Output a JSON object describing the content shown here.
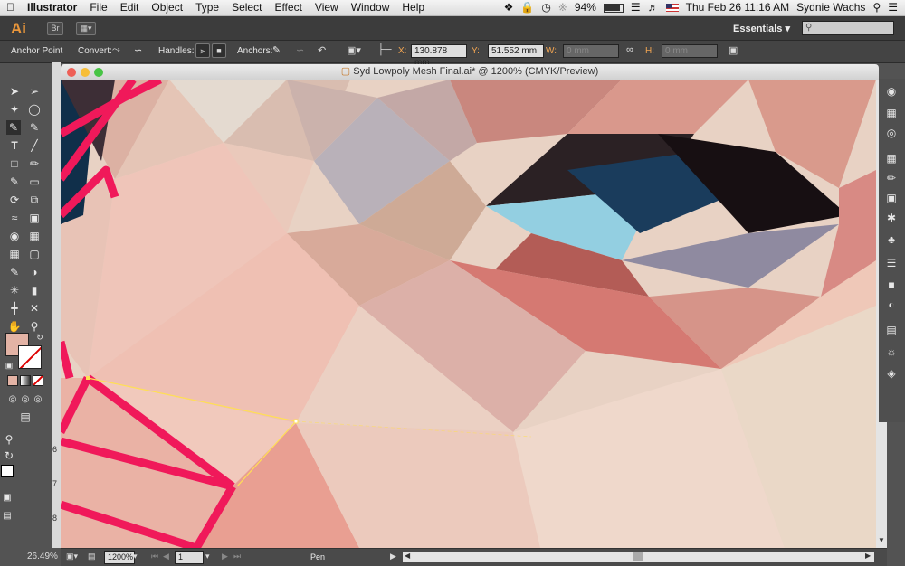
{
  "menubar": {
    "apple": "",
    "app": "Illustrator",
    "items": [
      "File",
      "Edit",
      "Object",
      "Type",
      "Select",
      "Effect",
      "View",
      "Window",
      "Help"
    ],
    "battery": "94%",
    "datetime": "Thu Feb 26  11:16 AM",
    "user": "Sydnie Wachs"
  },
  "appbar": {
    "logo": "Ai",
    "bridge": "Br",
    "workspace": "Essentials"
  },
  "control": {
    "tool_name": "Anchor Point",
    "convert": "Convert:",
    "handles": "Handles:",
    "anchors": "Anchors:",
    "x_label": "X:",
    "x_value": "130.878 mm",
    "y_label": "Y:",
    "y_value": "51.552 mm",
    "w_label": "W:",
    "w_value": "0 mm",
    "h_label": "H:",
    "h_value": "0 mm"
  },
  "document": {
    "title": "Syd Lowpoly Mesh Final.ai* @ 1200% (CMYK/Preview)"
  },
  "ruler": {
    "mark_6": "6",
    "mark_7": "7",
    "mark_8": "8"
  },
  "status": {
    "left_zoom": "26.49%",
    "zoom": "1200%",
    "artboard": "1",
    "tool": "Pen"
  },
  "colors": {
    "fill_swatch": "#e3b3a5",
    "accent_selection": "#ffdf55",
    "mesh_stroke": "#f0195a"
  }
}
